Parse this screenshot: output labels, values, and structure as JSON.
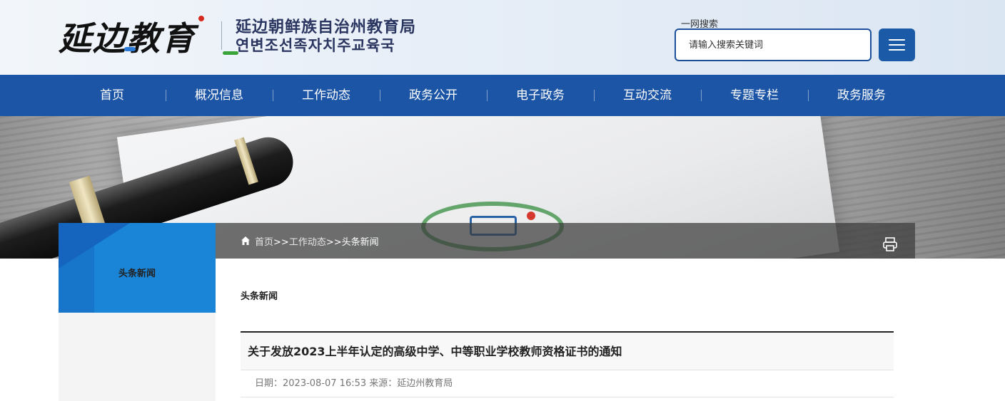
{
  "header": {
    "logo_calligraphy": "延边教育",
    "logo_name_cn": "延边朝鲜族自治州教育局",
    "logo_name_kr": "연변조선족자치주교육국",
    "search_label": "一网搜索",
    "search_placeholder": "请输入搜索关键词",
    "menu_icon": "hamburger-menu-icon"
  },
  "nav": {
    "items": [
      "首页",
      "概况信息",
      "工作动态",
      "政务公开",
      "电子政务",
      "互动交流",
      "专题专栏",
      "政务服务"
    ]
  },
  "breadcrumb": {
    "home": "首页",
    "sep1": ">>",
    "level2": "工作动态",
    "sep2": ">>",
    "current": "头条新闻",
    "print_icon": "print-icon"
  },
  "sidebar": {
    "title": "头条新闻"
  },
  "main": {
    "section_title": "头条新闻",
    "article_title": "关于发放2023上半年认定的高级中学、中等职业学校教师资格证书的通知",
    "meta": "日期：2023-08-07 16:53 来源：延边州教育局"
  },
  "colors": {
    "nav_bg": "#1c55a5",
    "accent_blue": "#1a84d6",
    "search_border": "#1b4f99"
  }
}
